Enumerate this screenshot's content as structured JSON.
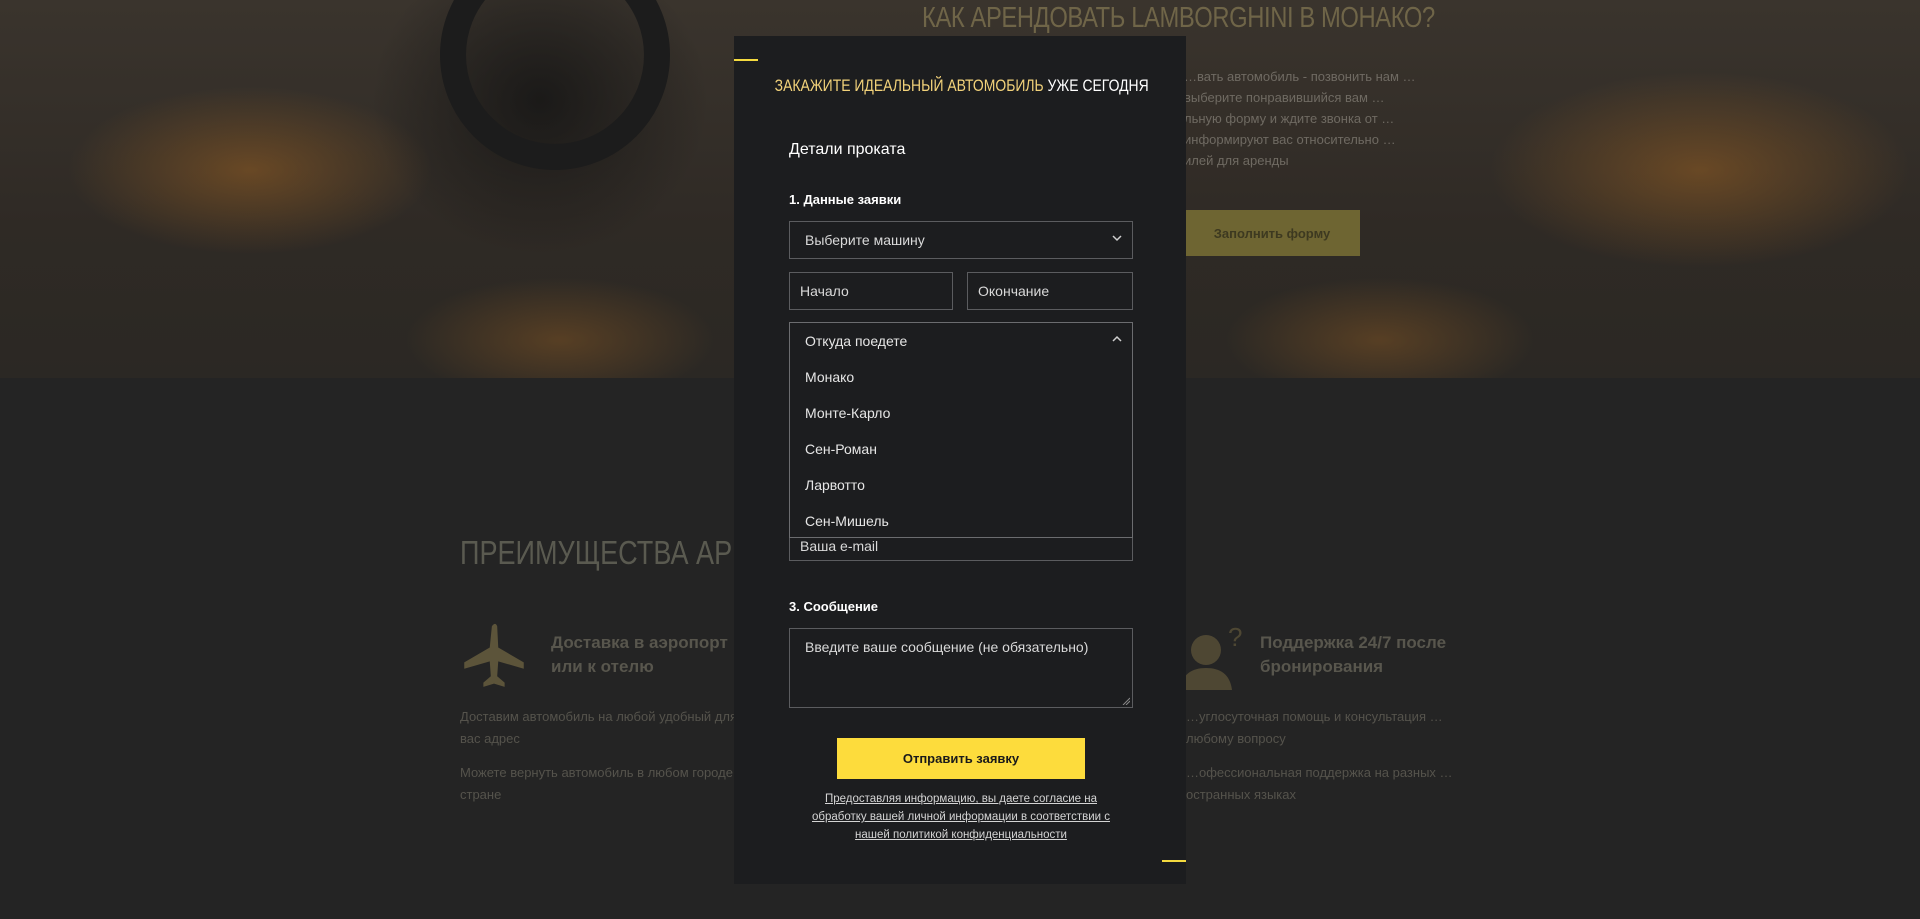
{
  "background": {
    "hero_title": "КАК АРЕНДОВАТЬ LAMBORGHINI В МОНАКО?",
    "hero_text": "…вать автомобиль - позвонить нам … выберите понравившийся вам … льную форму и ждите звонка от … информируют вас относительно … илей для аренды",
    "hero_button": "Заполнить форму",
    "advantages_title": "ПРЕИМУЩЕСТВА АРЕНД",
    "feature_left": {
      "title_line1": "Доставка в аэропорт",
      "title_line2": "или к отелю",
      "text1": "Доставим автомобиль на любой удобный для вас адрес",
      "text2": "Можете вернуть автомобиль в любом городе или стране"
    },
    "feature_right": {
      "title_line1": "Поддержка 24/7 после",
      "title_line2": "бронирования",
      "text1": "…углосуточная помощь и консультация …любому вопросу",
      "text2": "…офессиональная поддержка на разных …остранных языках"
    }
  },
  "modal": {
    "title_gold": "ЗАКАЖИТЕ ИДЕАЛЬНЫЙ АВТОМОБИЛЬ",
    "title_white": "УЖЕ СЕГОДНЯ",
    "details_heading": "Детали проката",
    "step1": "1. Данные заявки",
    "car_select": "Выберите машину",
    "start_placeholder": "Начало",
    "end_placeholder": "Окончание",
    "from_select": "Откуда поедете",
    "from_options": [
      "Монако",
      "Монте-Карло",
      "Сен-Роман",
      "Ларвотто",
      "Сен-Мишель"
    ],
    "email_placeholder": "Ваша e-mail",
    "step3": "3. Сообщение",
    "message_placeholder": "Введите ваше сообщение (не обязательно)",
    "submit": "Отправить заявку",
    "consent": "Предоставляя информацию, вы даете согласие на обработку вашей личной информации в соответствии с нашей политикой конфиденциальности"
  },
  "colors": {
    "accent": "#fddc3c",
    "title_gold": "#f2d27a",
    "modal_bg": "#1c1d1f"
  }
}
